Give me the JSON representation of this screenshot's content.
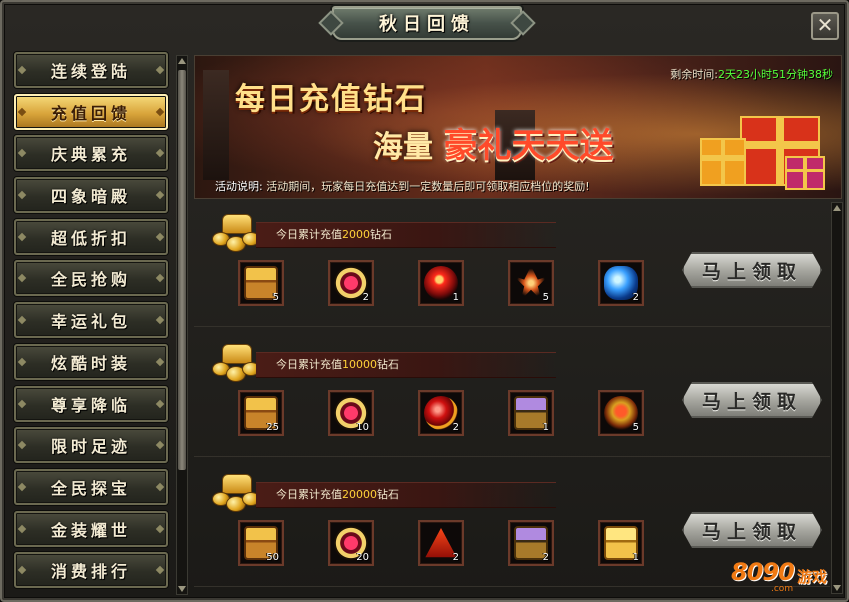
{
  "window": {
    "title": "秋日回馈",
    "close_glyph": "✕"
  },
  "sidebar": {
    "items": [
      {
        "label": "连续登陆",
        "active": false
      },
      {
        "label": "充值回馈",
        "active": true
      },
      {
        "label": "庆典累充",
        "active": false
      },
      {
        "label": "四象暗殿",
        "active": false
      },
      {
        "label": "超低折扣",
        "active": false
      },
      {
        "label": "全民抢购",
        "active": false
      },
      {
        "label": "幸运礼包",
        "active": false
      },
      {
        "label": "炫酷时装",
        "active": false
      },
      {
        "label": "尊享降临",
        "active": false
      },
      {
        "label": "限时足迹",
        "active": false
      },
      {
        "label": "全民探宝",
        "active": false
      },
      {
        "label": "金装耀世",
        "active": false
      },
      {
        "label": "消费排行",
        "active": false
      }
    ]
  },
  "banner": {
    "headline": "每日充值钻石",
    "sub_prefix": "海量",
    "sub_highlight": "豪礼天天送",
    "time_label": "剩余时间:",
    "time_value": "2天23小时51分钟38秒",
    "desc_label": "活动说明:",
    "desc_text": "活动期间，玩家每日充值达到一定数量后即可领取相应档位的奖励!"
  },
  "tiers": [
    {
      "prefix": "今日累计充值",
      "amount": "2000",
      "suffix": "钻石",
      "claim_label": "马上领取",
      "items": [
        {
          "icon": "chest-icon",
          "count": "5"
        },
        {
          "icon": "ring-icon",
          "count": "2"
        },
        {
          "icon": "orb-icon",
          "count": "1"
        },
        {
          "icon": "crystal-icon",
          "count": "5"
        },
        {
          "icon": "gem-icon",
          "count": "2"
        }
      ]
    },
    {
      "prefix": "今日累计充值",
      "amount": "10000",
      "suffix": "钻石",
      "claim_label": "马上领取",
      "items": [
        {
          "icon": "chest-icon",
          "count": "25"
        },
        {
          "icon": "ring-icon",
          "count": "10"
        },
        {
          "icon": "orb-red-icon",
          "count": "2"
        },
        {
          "icon": "chest-purple-icon",
          "count": "1"
        },
        {
          "icon": "dragon-icon",
          "count": "5"
        }
      ]
    },
    {
      "prefix": "今日累计充值",
      "amount": "20000",
      "suffix": "钻石",
      "claim_label": "马上领取",
      "items": [
        {
          "icon": "chest-icon",
          "count": "50"
        },
        {
          "icon": "ring-icon",
          "count": "20"
        },
        {
          "icon": "triangle-icon",
          "count": "2"
        },
        {
          "icon": "chest-purple-icon",
          "count": "2"
        },
        {
          "icon": "chest-gold-icon",
          "count": "1"
        }
      ]
    }
  ],
  "watermark": {
    "number": "8090",
    "text": "游戏",
    "domain": ".com"
  },
  "colors": {
    "accent_gold": "#ffd23a",
    "timer_green": "#55ff3a",
    "highlight_red": "#ff4a2a"
  }
}
